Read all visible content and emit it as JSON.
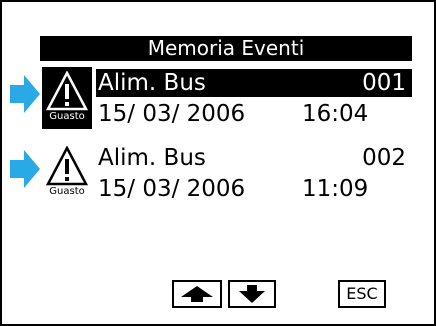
{
  "header": {
    "title": "Memoria Eventi"
  },
  "events": [
    {
      "name": "Alim. Bus",
      "number": "001",
      "date": "15/ 03/ 2006",
      "time": "16:04",
      "icon_caption": "Guasto",
      "icon": "warning-icon",
      "selected": true
    },
    {
      "name": "Alim. Bus",
      "number": "002",
      "date": "15/ 03/ 2006",
      "time": "11:09",
      "icon_caption": "Guasto",
      "icon": "warning-icon",
      "selected": false
    }
  ],
  "buttons": {
    "up_icon": "up-arrow-icon",
    "down_icon": "down-arrow-icon",
    "esc_label": "ESC"
  },
  "colors": {
    "pointer_arrow": "#29a9e6",
    "foreground": "#000000",
    "background": "#ffffff"
  }
}
